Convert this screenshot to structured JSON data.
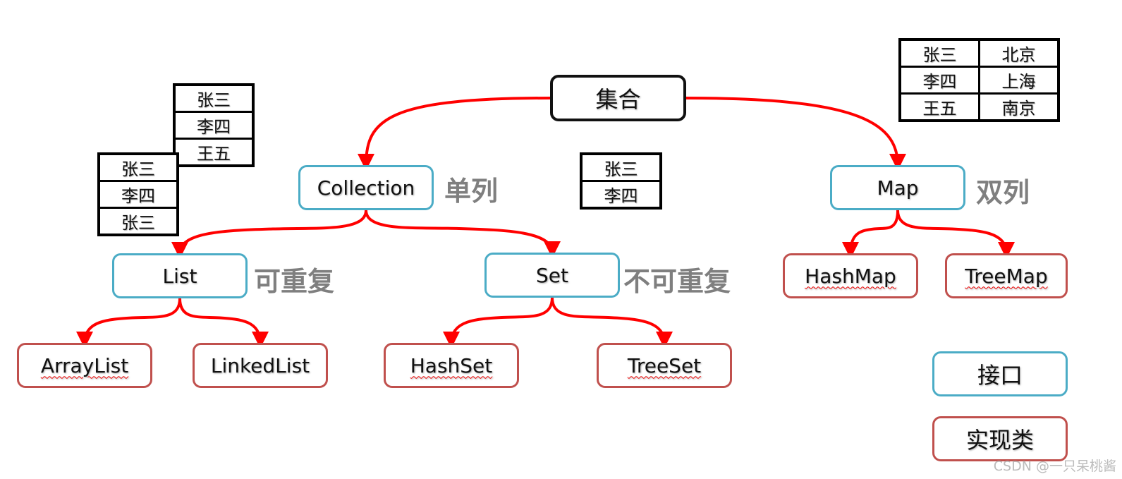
{
  "nodes": {
    "root": "集合",
    "collection": "Collection",
    "map": "Map",
    "list": "List",
    "set": "Set",
    "arraylist": "ArrayList",
    "linkedlist": "LinkedList",
    "hashset": "HashSet",
    "treeset": "TreeSet",
    "hashmap": "HashMap",
    "treemap": "TreeMap"
  },
  "notes": {
    "single_column": "单列",
    "double_column": "双列",
    "repeatable": "可重复",
    "not_repeatable": "不可重复"
  },
  "legend": {
    "interface": "接口",
    "implementation": "实现类"
  },
  "tables": {
    "list_example_back": [
      "张三",
      "李四",
      "王五"
    ],
    "list_example_front": [
      "张三",
      "李四",
      "张三"
    ],
    "set_example": [
      "张三",
      "李四"
    ],
    "map_example": [
      [
        "张三",
        "北京"
      ],
      [
        "李四",
        "上海"
      ],
      [
        "王五",
        "南京"
      ]
    ]
  },
  "edges": [
    [
      "root",
      "collection"
    ],
    [
      "root",
      "map"
    ],
    [
      "collection",
      "list"
    ],
    [
      "collection",
      "set"
    ],
    [
      "list",
      "arraylist"
    ],
    [
      "list",
      "linkedlist"
    ],
    [
      "set",
      "hashset"
    ],
    [
      "set",
      "treeset"
    ],
    [
      "map",
      "hashmap"
    ],
    [
      "map",
      "treemap"
    ]
  ],
  "colors": {
    "arrow": "#ff0000",
    "interface_border": "#4bacc6",
    "impl_border": "#c0504d",
    "note_text": "#7f7f7f"
  },
  "watermark": "CSDN @一只呆桃酱"
}
